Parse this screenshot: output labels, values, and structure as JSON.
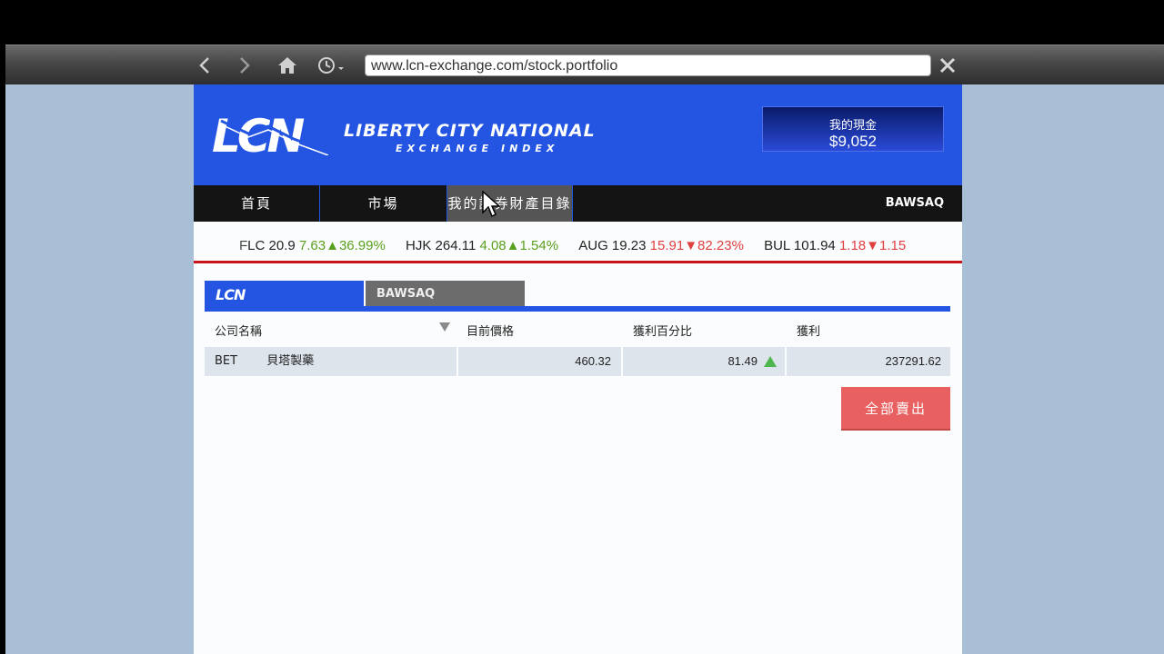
{
  "browser": {
    "url": "www.lcn-exchange.com/stock.portfolio",
    "icons": [
      "back-arrow-icon",
      "forward-arrow-icon",
      "home-icon",
      "history-clock-icon",
      "close-icon"
    ]
  },
  "header": {
    "logo_letters": "LCN",
    "logo_line1": "LIBERTY CITY NATIONAL",
    "logo_line2": "EXCHANGE INDEX",
    "cash_label": "我的現金",
    "cash_value": "$9,052"
  },
  "nav": {
    "items": [
      "首頁",
      "市場",
      "我的證券財產目錄"
    ],
    "active_index": 2,
    "right_logo": "BAWSAQ"
  },
  "ticker": [
    {
      "symbol": "FLC",
      "price": "20.9",
      "change": "7.63",
      "pct": "36.99%",
      "dir": "up"
    },
    {
      "symbol": "HJK",
      "price": "264.11",
      "change": "4.08",
      "pct": "1.54%",
      "dir": "up"
    },
    {
      "symbol": "AUG",
      "price": "19.23",
      "change": "15.91",
      "pct": "82.23%",
      "dir": "down"
    },
    {
      "symbol": "BUL",
      "price": "101.94",
      "change": "1.18",
      "pct": "1.15",
      "dir": "down"
    }
  ],
  "tabs": {
    "lcn": "LCN",
    "bawsaq": "BAWSAQ"
  },
  "table": {
    "headers": [
      "公司名稱",
      "目前價格",
      "獲利百分比",
      "獲利"
    ],
    "rows": [
      {
        "symbol": "BET",
        "name": "貝塔製藥",
        "price": "460.32",
        "profit_pct": "81.49",
        "profit": "237291.62",
        "trend": "up"
      }
    ]
  },
  "actions": {
    "sell_all": "全部賣出"
  },
  "colors": {
    "brand_blue": "#2455e2",
    "ticker_up": "#5aa020",
    "ticker_down": "#e04040",
    "sell_button": "#e86060",
    "divider_red": "#c7151b"
  }
}
